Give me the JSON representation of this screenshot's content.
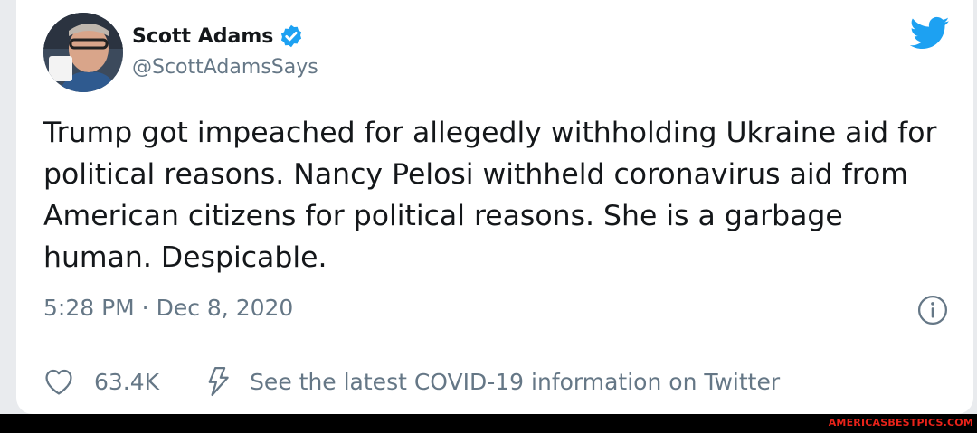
{
  "tweet": {
    "author_name": "Scott Adams",
    "author_handle": "@ScottAdamsSays",
    "verified": true,
    "text": "Trump got impeached for allegedly withholding Ukraine aid for political reasons. Nancy Pelosi withheld coronavirus aid from American citizens for political reasons. She is a garbage human. Despicable.",
    "timestamp": "5:28 PM · Dec 8, 2020",
    "likes": "63.4K",
    "covid_notice": "See the latest COVID-19 information on Twitter"
  },
  "icons": {
    "brand": "twitter-bird-icon",
    "verified": "verified-badge-icon",
    "info": "info-icon",
    "like": "heart-icon",
    "covid": "lightning-bolt-icon"
  },
  "colors": {
    "twitter_blue": "#1da1f2",
    "text": "#14171a",
    "secondary": "#657786",
    "watermark": "#e8231a"
  },
  "footer": {
    "watermark": "AMERICASBESTPICS.COM"
  }
}
